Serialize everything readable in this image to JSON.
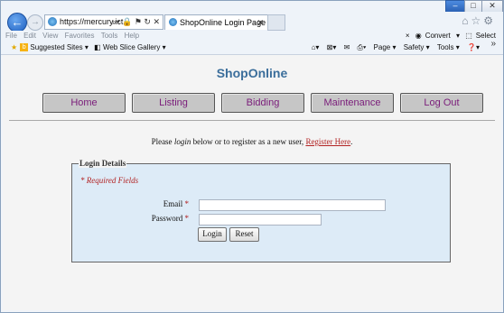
{
  "browser": {
    "address": "https://mercury.ict.",
    "tab_title": "ShopOnline Login Page",
    "menu": [
      "File",
      "Edit",
      "View",
      "Favorites",
      "Tools",
      "Help"
    ],
    "menu_right": {
      "close": "×",
      "convert": "Convert",
      "select": "Select"
    },
    "favorites": {
      "suggested_sites": "Suggested Sites ▾",
      "web_slice": "Web Slice Gallery ▾"
    },
    "command_bar": {
      "page": "Page ▾",
      "safety": "Safety ▾",
      "tools": "Tools ▾"
    }
  },
  "page": {
    "site_title": "ShopOnline",
    "nav": [
      "Home",
      "Listing",
      "Bidding",
      "Maintenance",
      "Log Out"
    ],
    "intro_before": "Please ",
    "intro_login": "login",
    "intro_after": " below or to register as a new user, ",
    "register_link": "Register Here",
    "intro_end": ".",
    "legend": "Login Details",
    "required_note": "* Required Fields",
    "email_label": "Email ",
    "password_label": "Password ",
    "required_star": "*",
    "email_value": "",
    "password_value": "",
    "login_button": "Login",
    "reset_button": "Reset"
  },
  "colors": {
    "title": "#3b6e9b",
    "nav_text": "#7a1c7a",
    "required": "#b22222",
    "fieldset_bg": "#ddebf7"
  }
}
